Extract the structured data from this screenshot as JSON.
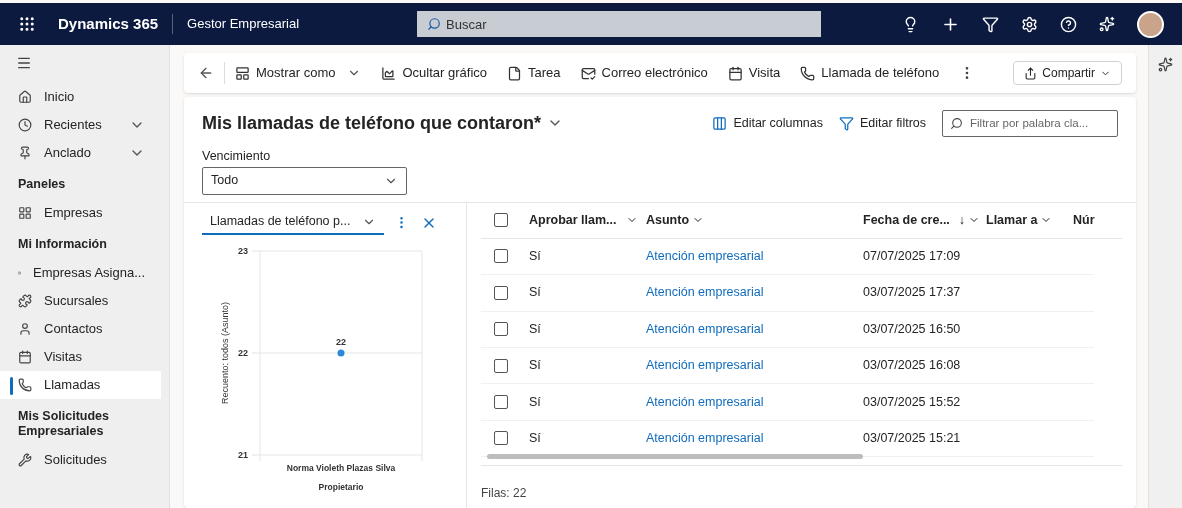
{
  "topbar": {
    "app_name": "Dynamics 365",
    "area": "Gestor Empresarial",
    "search": {
      "placeholder": "Buscar"
    }
  },
  "sidebar": {
    "items": [
      {
        "kind": "item",
        "label": "Inicio",
        "selected": false
      },
      {
        "kind": "item",
        "label": "Recientes",
        "selected": false,
        "expanded": false
      },
      {
        "kind": "item",
        "label": "Anclado",
        "selected": false,
        "expanded": false
      },
      {
        "kind": "header",
        "label": "Paneles"
      },
      {
        "kind": "item",
        "label": "Empresas",
        "selected": false
      },
      {
        "kind": "header",
        "label": "Mi Información"
      },
      {
        "kind": "item",
        "label": "Empresas Asigna...",
        "selected": false
      },
      {
        "kind": "item",
        "label": "Sucursales",
        "selected": false
      },
      {
        "kind": "item",
        "label": "Contactos",
        "selected": false
      },
      {
        "kind": "item",
        "label": "Visitas",
        "selected": false
      },
      {
        "kind": "item",
        "label": "Llamadas",
        "selected": true
      },
      {
        "kind": "header",
        "label": "Mis Solicitudes Empresariales"
      },
      {
        "kind": "item",
        "label": "Solicitudes",
        "selected": false
      }
    ]
  },
  "commands": [
    "Mostrar como",
    "Ocultar gráfico",
    "Tarea",
    "Correo electrónico",
    "Visita",
    "Llamada de teléfono"
  ],
  "share": "Compartir",
  "view": {
    "title": "Mis llamadas de teléfono que contaron*",
    "actions": [
      "Editar columnas",
      "Editar filtros"
    ],
    "search": {
      "placeholder": "Filtrar por palabra cla..."
    }
  },
  "filter": {
    "label": "Vencimiento",
    "value": "Todo"
  },
  "chart_panel": {
    "selector": "Llamadas de teléfono p...",
    "chart_data": {
      "type": "scatter",
      "xlabel": "Propietario",
      "ylabel": "Recuento: todos (Asunto)",
      "categories": [
        "Norma Violeth Plazas Silva"
      ],
      "series": [
        {
          "color": "#2b88d8",
          "values": [
            22
          ]
        }
      ],
      "ylim": [
        21,
        23
      ],
      "yticks": [
        21,
        22,
        23
      ],
      "data_labels": true
    }
  },
  "grid": {
    "select_all": {
      "checked": false
    },
    "columns": [
      {
        "label": "Aprobar llam..."
      },
      {
        "label": "Asunto"
      },
      {
        "label": "Fecha de cre...",
        "sort_arrow": "↓"
      },
      {
        "label": "Llamar a"
      },
      {
        "label": "Núr"
      }
    ],
    "rows": [
      {
        "selected": false,
        "approve": "Sí",
        "subject": "Atención empresarial",
        "created": "07/07/2025 17:09"
      },
      {
        "selected": false,
        "approve": "Sí",
        "subject": "Atención empresarial",
        "created": "03/07/2025 17:37"
      },
      {
        "selected": false,
        "approve": "Sí",
        "subject": "Atención empresarial",
        "created": "03/07/2025 16:50"
      },
      {
        "selected": false,
        "approve": "Sí",
        "subject": "Atención empresarial",
        "created": "03/07/2025 16:08"
      },
      {
        "selected": false,
        "approve": "Sí",
        "subject": "Atención empresarial",
        "created": "03/07/2025 15:52"
      },
      {
        "selected": false,
        "approve": "Sí",
        "subject": "Atención empresarial",
        "created": "03/07/2025 15:21"
      }
    ],
    "footer": "Filas: 22"
  }
}
